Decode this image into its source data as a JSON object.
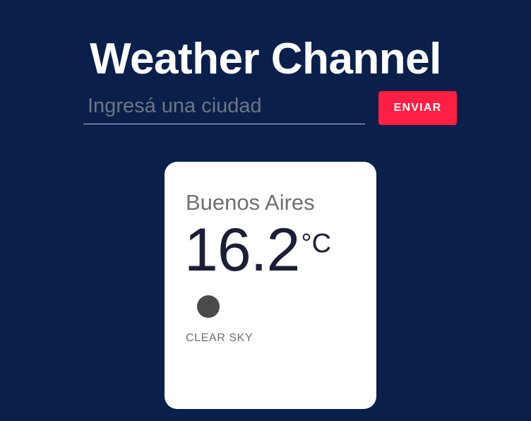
{
  "header": {
    "title": "Weather Channel"
  },
  "search": {
    "placeholder": "Ingresá una ciudad",
    "value": "",
    "submit_label": "ENVIAR"
  },
  "weather_card": {
    "city": "Buenos Aires",
    "temperature": "16.2",
    "unit": "°C",
    "icon": "clear-sky-icon",
    "description": "CLEAR SKY"
  },
  "colors": {
    "background": "#0a1f4a",
    "accent": "#ff1f44",
    "card": "#ffffff"
  }
}
